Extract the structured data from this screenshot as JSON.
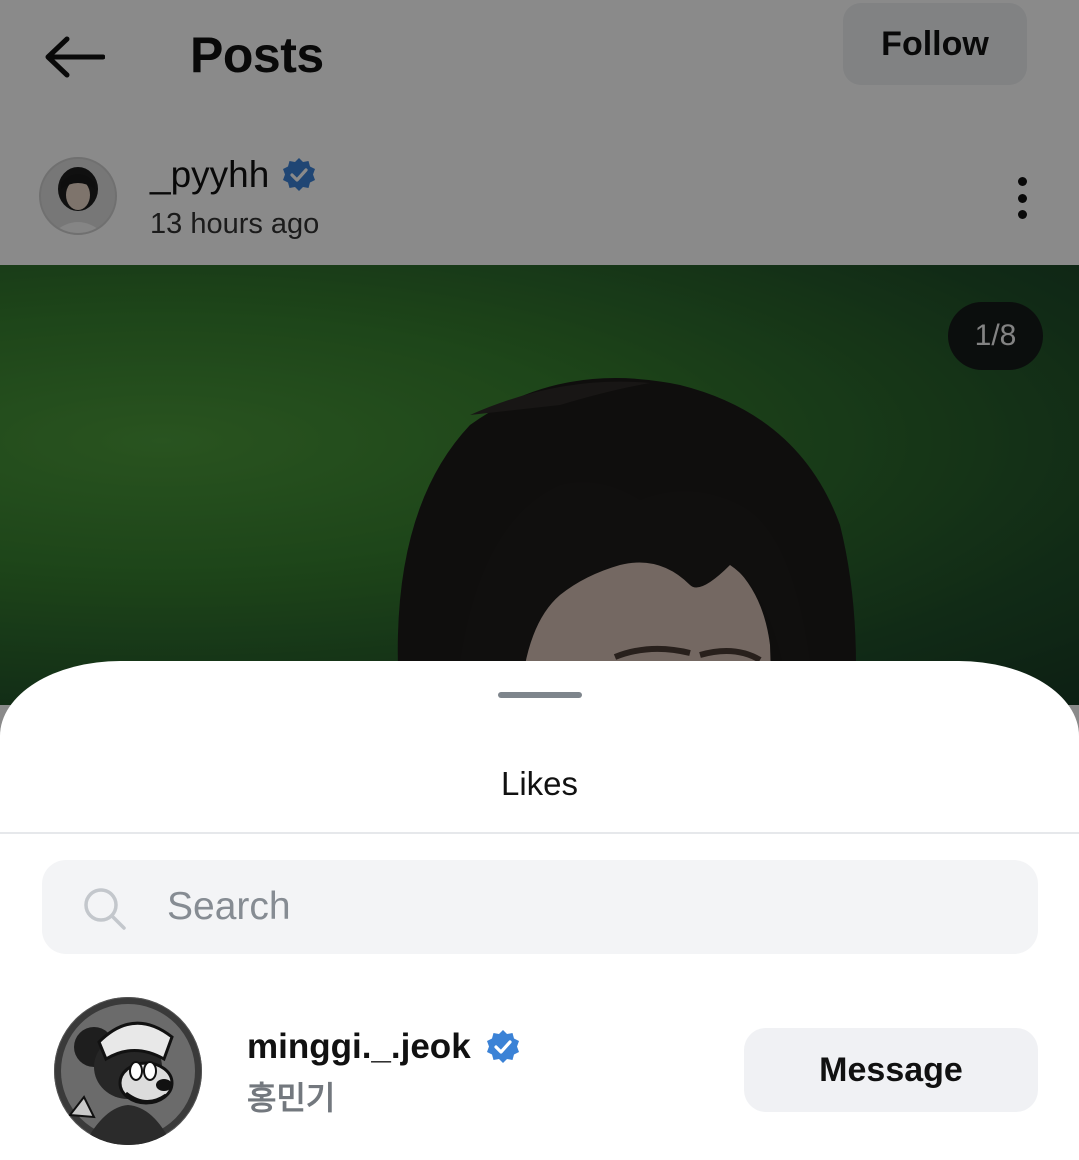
{
  "header": {
    "title": "Posts",
    "follow_label": "Follow"
  },
  "post": {
    "author": {
      "username": "_pyyhh",
      "verified": true,
      "time_ago": "13 hours ago"
    },
    "image_counter": "1/8"
  },
  "likes_sheet": {
    "title": "Likes",
    "search": {
      "placeholder": "Search",
      "value": ""
    },
    "users": [
      {
        "username": "minggi._.jeok",
        "display_name": "홍민기",
        "verified": true,
        "action_label": "Message"
      }
    ]
  },
  "colors": {
    "verified_badge": "#3b82d6",
    "overlay": "rgba(0,0,0,0.46)",
    "button_bg": "#f0f1f4",
    "search_bg": "#f3f4f6"
  },
  "icons": [
    "back-arrow-icon",
    "verified-badge-icon",
    "more-vertical-icon",
    "search-icon"
  ]
}
